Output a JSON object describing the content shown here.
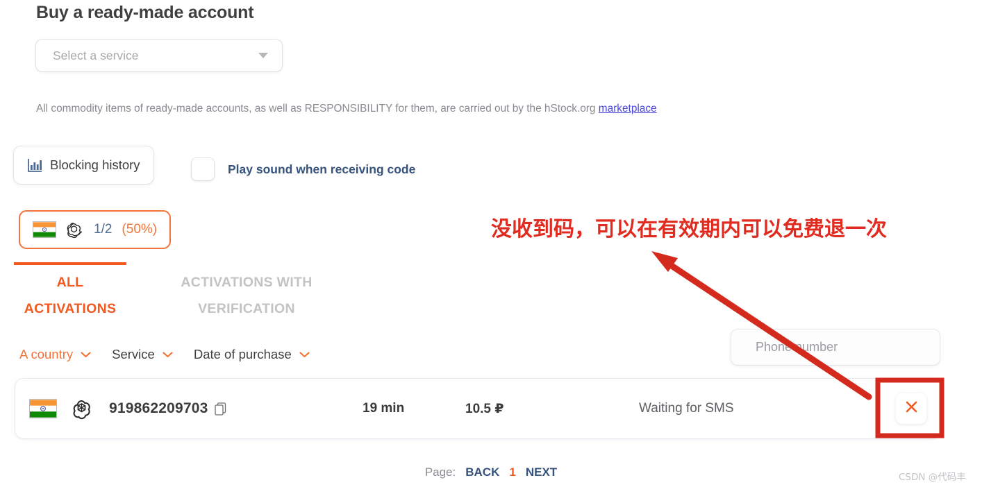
{
  "page": {
    "title": "Buy a ready-made account"
  },
  "service_select": {
    "placeholder": "Select a service",
    "caret_icon": "chevron-down-icon"
  },
  "notice": {
    "text": "All commodity items of ready-made accounts, as well as RESPONSIBILITY for them, are carried out by the hStock.org ",
    "link_text": "marketplace"
  },
  "blocking_history": {
    "label": "Blocking history",
    "icon": "bar-chart-icon"
  },
  "sound_option": {
    "label": "Play sound when receiving code",
    "checked": false
  },
  "counter_badge": {
    "flag": "india-flag-icon",
    "service_icon": "openai-logo-icon",
    "fraction": "1/2",
    "percent": "(50%)"
  },
  "tabs": [
    {
      "label": "ALL ACTIVATIONS",
      "active": true
    },
    {
      "label": "ACTIVATIONS WITH VERIFICATION",
      "active": false
    }
  ],
  "filters": [
    {
      "label": "A country",
      "icon": "chevron-down-icon",
      "active": true
    },
    {
      "label": "Service",
      "icon": "chevron-down-icon",
      "active": false
    },
    {
      "label": "Date of purchase",
      "icon": "chevron-down-icon",
      "active": false
    }
  ],
  "phone_search": {
    "placeholder": "Phone number",
    "value": ""
  },
  "table": {
    "rows": [
      {
        "flag": "india-flag-icon",
        "service_icon": "openai-logo-icon",
        "number": "919862209703",
        "copy_icon": "copy-icon",
        "time": "19 min",
        "price": "10.5 ₽",
        "status": "Waiting for SMS",
        "cancel_icon": "close-icon"
      }
    ]
  },
  "pagination": {
    "label": "Page:",
    "back": "BACK",
    "current": "1",
    "next": "NEXT"
  },
  "annotation": {
    "text": "没收到码，可以在有效期内可以免费退一次",
    "color": "#e02b20"
  },
  "watermark": {
    "text": "CSDN @代码丰"
  },
  "colors": {
    "accent_orange": "#f2591f",
    "badge_orange": "#f2743a",
    "navy": "#36537e",
    "link_blue": "#4a4ad6",
    "annotation_red": "#e02b20"
  }
}
